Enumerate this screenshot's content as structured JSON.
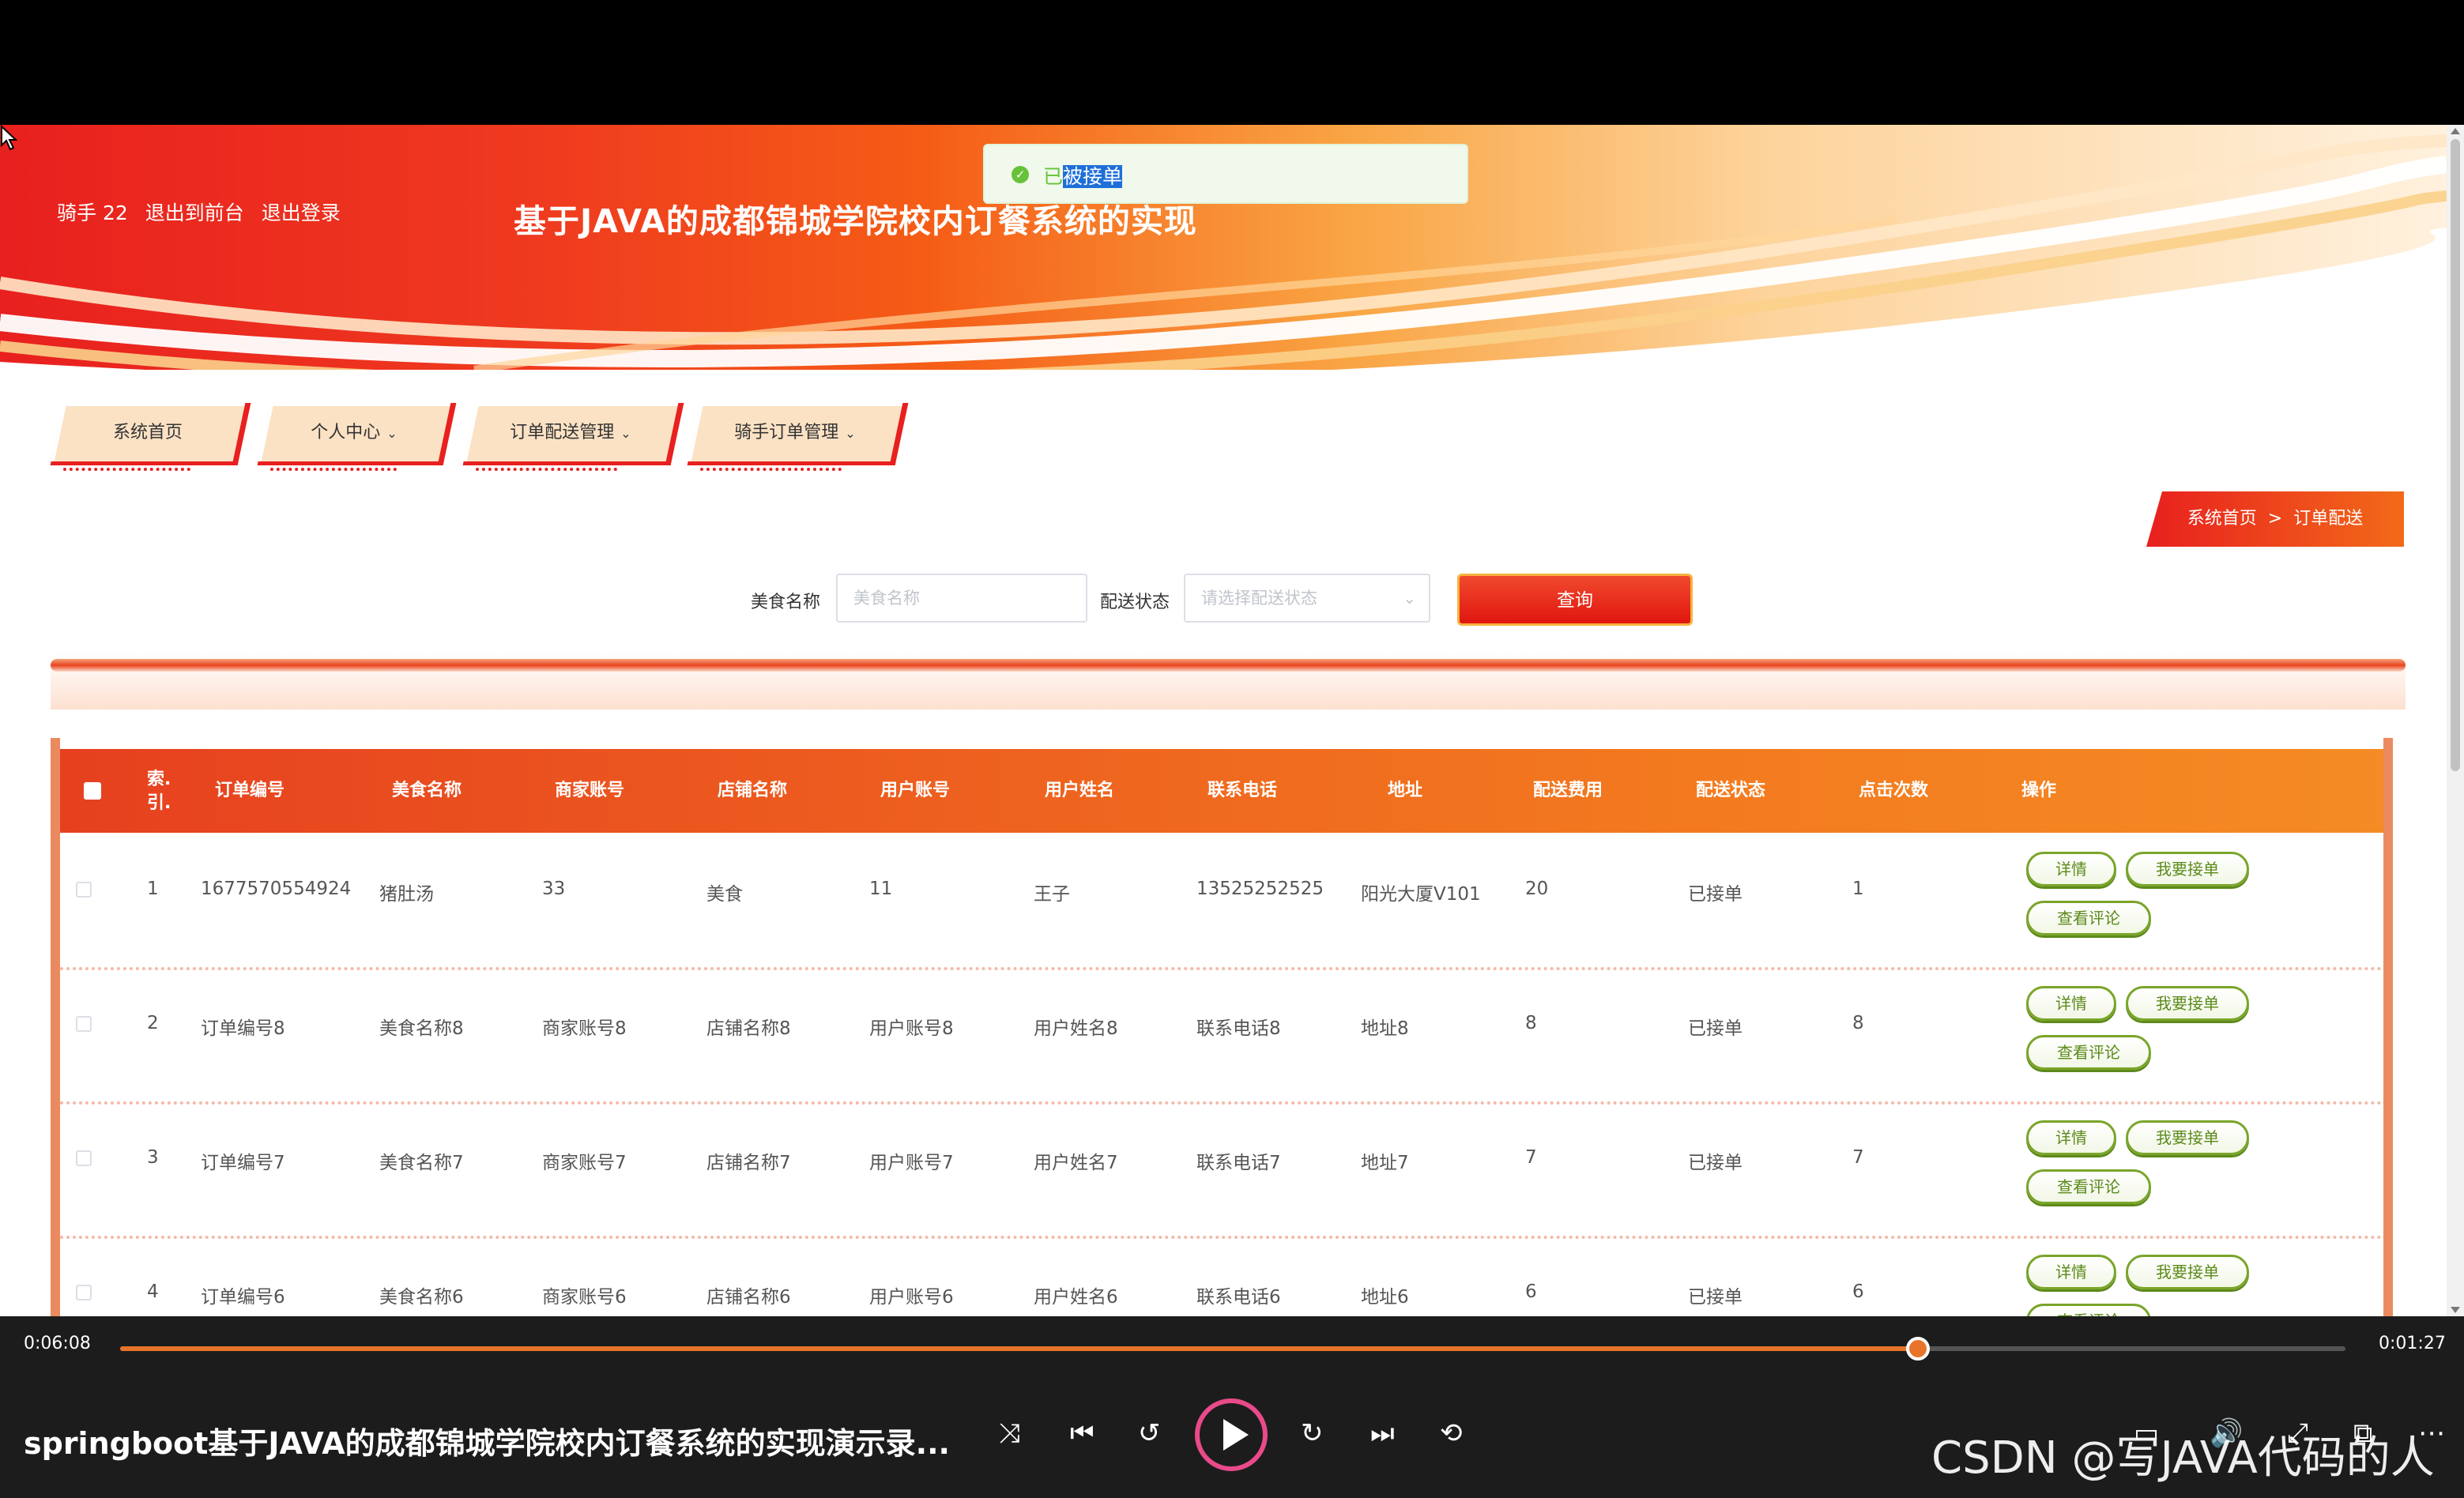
{
  "header": {
    "user_label": "骑手 22",
    "back_to_front": "退出到前台",
    "logout": "退出登录",
    "title": "基于JAVA的成都锦城学院校内订餐系统的实现"
  },
  "toast": {
    "prefix": "已",
    "highlight": "被接单"
  },
  "nav": [
    {
      "label": "系统首页",
      "dropdown": ""
    },
    {
      "label": "个人中心",
      "dropdown": "⌄"
    },
    {
      "label": "订单配送管理",
      "dropdown": "⌄"
    },
    {
      "label": "骑手订单管理",
      "dropdown": "⌄"
    }
  ],
  "breadcrumb": {
    "home": "系统首页",
    "sep": ">",
    "current": "订单配送"
  },
  "search": {
    "food_label": "美食名称",
    "food_placeholder": "美食名称",
    "status_label": "配送状态",
    "status_placeholder": "请选择配送状态",
    "query_button": "查询"
  },
  "table": {
    "headers": [
      "索引",
      "订单编号",
      "美食名称",
      "商家账号",
      "店铺名称",
      "用户账号",
      "用户姓名",
      "联系电话",
      "地址",
      "配送费用",
      "配送状态",
      "点击次数",
      "操作"
    ],
    "index_header_top": "索.",
    "index_header_bottom": "引.",
    "rows": [
      [
        "1",
        "1677570554924",
        "猪肚汤",
        "33",
        "美食",
        "11",
        "王子",
        "13525252525",
        "阳光大厦V101",
        "20",
        "已接单",
        "1"
      ],
      [
        "2",
        "订单编号8",
        "美食名称8",
        "商家账号8",
        "店铺名称8",
        "用户账号8",
        "用户姓名8",
        "联系电话8",
        "地址8",
        "8",
        "已接单",
        "8"
      ],
      [
        "3",
        "订单编号7",
        "美食名称7",
        "商家账号7",
        "店铺名称7",
        "用户账号7",
        "用户姓名7",
        "联系电话7",
        "地址7",
        "7",
        "已接单",
        "7"
      ],
      [
        "4",
        "订单编号6",
        "美食名称6",
        "商家账号6",
        "店铺名称6",
        "用户账号6",
        "用户姓名6",
        "联系电话6",
        "地址6",
        "6",
        "已接单",
        "6"
      ]
    ],
    "actions": {
      "detail": "详情",
      "take": "我要接单",
      "reviews": "查看评论"
    }
  },
  "player": {
    "elapsed": "0:06:08",
    "remaining": "0:01:27",
    "progress": 0.808,
    "title": "springboot基于JAVA的成都锦城学院校内订餐系统的实现演示录...",
    "watermark": "CSDN @写JAVA代码的人"
  },
  "colors": {
    "accent": "#e8201f",
    "orange": "#f37a1f",
    "success": "#67c23a",
    "action_green": "#7aa52a"
  }
}
